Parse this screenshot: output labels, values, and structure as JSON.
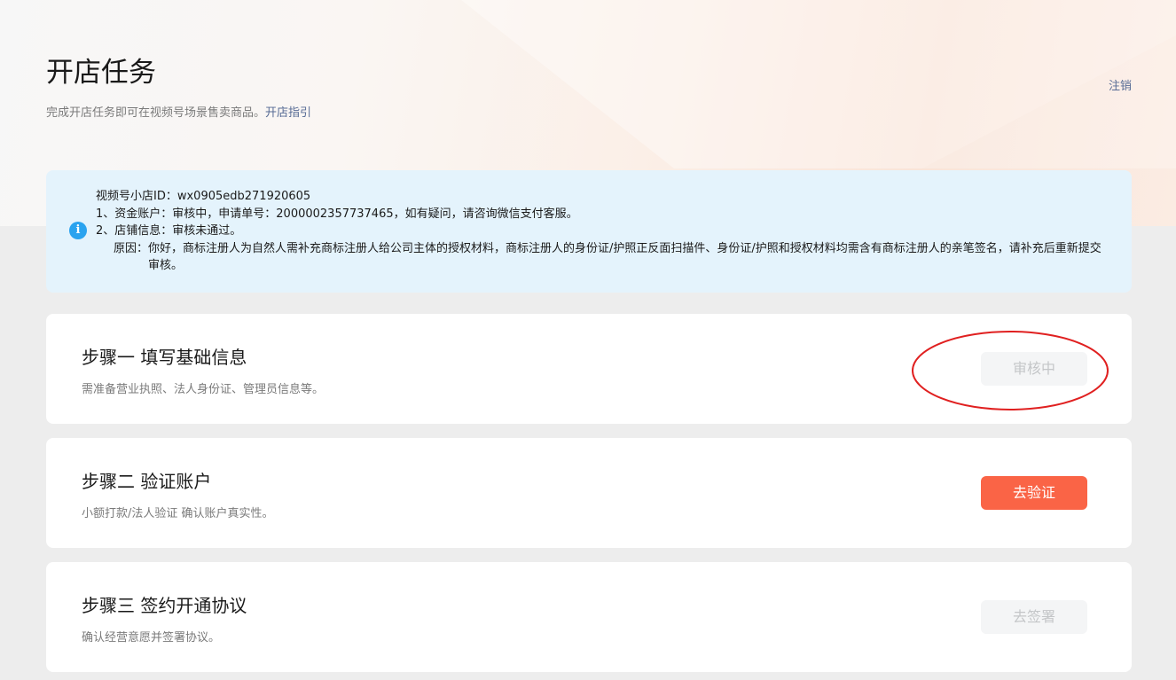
{
  "header": {
    "title": "开店任务",
    "subtitle": "完成开店任务即可在视频号场景售卖商品。",
    "guide_link": "开店指引",
    "logout": "注销"
  },
  "notice": {
    "icon": "info-icon",
    "shop_id_line": "视频号小店ID：wx0905edb271920605",
    "fund_account_line": "1、资金账户：审核中，申请单号：2000002357737465，如有疑问，请咨询微信支付客服。",
    "store_info_line": "2、店铺信息：审核未通过。",
    "reason_label": "原因：",
    "reason_text": "你好，商标注册人为自然人需补充商标注册人给公司主体的授权材料，商标注册人的身份证/护照正反面扫描件、身份证/护照和授权材料均需含有商标注册人的亲笔签名，请补充后重新提交审核。"
  },
  "steps": [
    {
      "title": "步骤一 填写基础信息",
      "desc": "需准备营业执照、法人身份证、管理员信息等。",
      "button": "审核中",
      "button_state": "disabled"
    },
    {
      "title": "步骤二 验证账户",
      "desc": "小额打款/法人验证 确认账户真实性。",
      "button": "去验证",
      "button_state": "primary"
    },
    {
      "title": "步骤三 签约开通协议",
      "desc": "确认经营意愿并签署协议。",
      "button": "去签署",
      "button_state": "disabled"
    }
  ],
  "colors": {
    "primary_button": "#fa6446",
    "link": "#576b95",
    "notice_bg": "#e4f3fc",
    "info_icon": "#2aa3ef",
    "annotation_circle": "#e02020"
  }
}
